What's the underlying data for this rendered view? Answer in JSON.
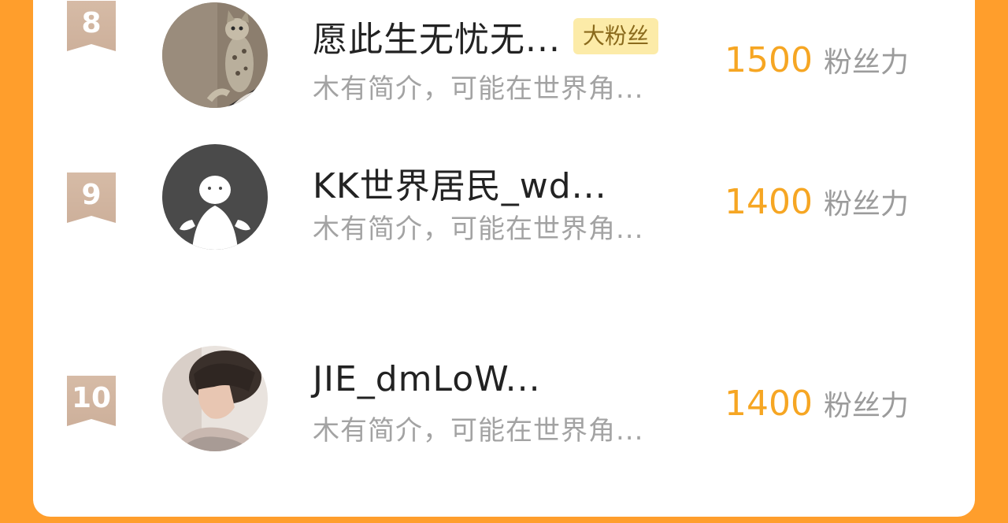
{
  "ranking": [
    {
      "rank": "8",
      "name": "愿此生无忧无...",
      "tag": "大粉丝",
      "bio": "木有简介，可能在世界角...",
      "score": "1500",
      "score_unit": "粉丝力",
      "avatar_icon": "cat-photo-avatar"
    },
    {
      "rank": "9",
      "name": "KK世界居民_wd...",
      "tag": "",
      "bio": "木有简介，可能在世界角...",
      "score": "1400",
      "score_unit": "粉丝力",
      "avatar_icon": "default-person-avatar"
    },
    {
      "rank": "10",
      "name": "JIE_dmLoW...",
      "tag": "",
      "bio": "木有简介，可能在世界角...",
      "score": "1400",
      "score_unit": "粉丝力",
      "avatar_icon": "person-photo-avatar"
    }
  ],
  "colors": {
    "background": "#FF9E2C",
    "score": "#F6A623",
    "badge": "#D6BBA6",
    "tag_bg": "#FCEBA8"
  }
}
